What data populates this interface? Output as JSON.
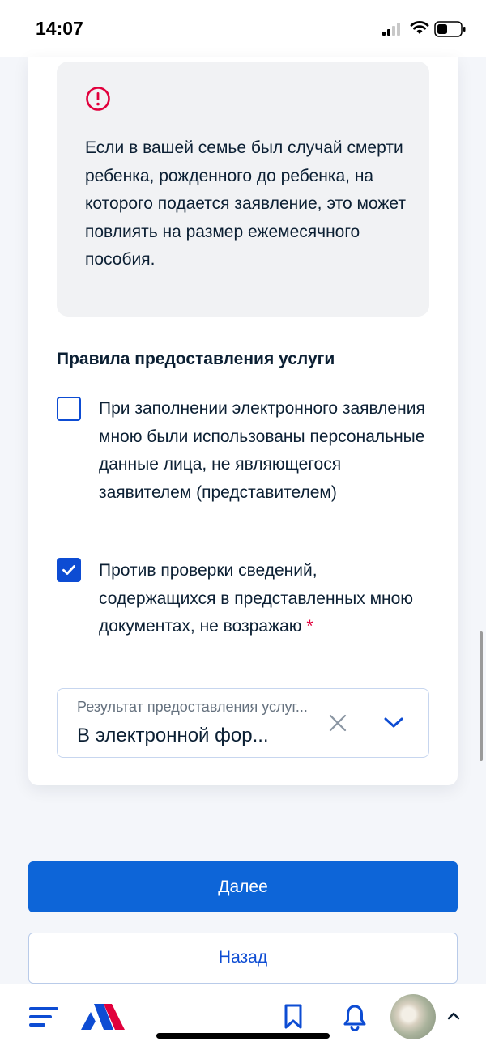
{
  "status_bar": {
    "time": "14:07"
  },
  "notice": {
    "icon": "alert-circle-icon",
    "text": "Если в вашей семье был случай смерти ребенка, рожденного до ребенка, на которого подается заявление, это может повлиять на размер ежемесячного пособия."
  },
  "rules": {
    "title": "Правила предоставления услуги",
    "items": [
      {
        "label": "При заполнении электронного заявления мною были использованы персональные данные лица, не являющегося заявителем (представителем)",
        "checked": false,
        "required": false
      },
      {
        "label": "Против проверки сведений, содержащихся в представленных мною документах, не возражаю",
        "checked": true,
        "required": true,
        "required_mark": "*"
      }
    ]
  },
  "result_select": {
    "label": "Результат предоставления услуг...",
    "value": "В электронной фор..."
  },
  "buttons": {
    "next": "Далее",
    "back": "Назад"
  },
  "colors": {
    "primary": "#0d65d8",
    "checkbox": "#0d4cd3",
    "alert": "#e1003c",
    "notice_bg": "#f1f2f4",
    "page_bg": "#f4f6fa"
  },
  "bottom_nav": {
    "icons": [
      "menu-icon",
      "gosuslugi-logo",
      "bookmark-icon",
      "bell-icon",
      "avatar",
      "chevron-up-icon"
    ]
  }
}
